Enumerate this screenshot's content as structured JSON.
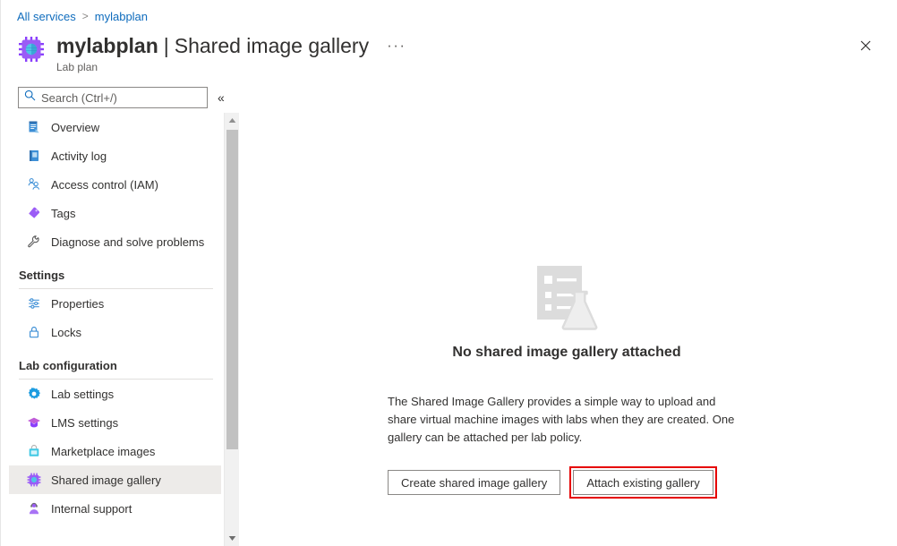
{
  "breadcrumb": {
    "items": [
      {
        "label": "All services",
        "link": true
      },
      {
        "label": "mylabplan",
        "link": true
      }
    ],
    "separator": ">"
  },
  "header": {
    "icon_name": "lab-plan-chip-icon",
    "resource_name": "mylabplan",
    "divider": "|",
    "page_title": "Shared image gallery",
    "subtitle": "Lab plan",
    "more_menu": "···",
    "close_label": "✕"
  },
  "search": {
    "placeholder": "Search (Ctrl+/)",
    "value": "",
    "icon_name": "search-icon",
    "collapse_label": "«"
  },
  "sidebar": {
    "top_items": [
      {
        "label": "Overview",
        "icon": "overview-icon"
      },
      {
        "label": "Activity log",
        "icon": "activity-log-icon"
      },
      {
        "label": "Access control (IAM)",
        "icon": "access-control-icon"
      },
      {
        "label": "Tags",
        "icon": "tags-icon"
      },
      {
        "label": "Diagnose and solve problems",
        "icon": "diagnose-icon"
      }
    ],
    "groups": [
      {
        "title": "Settings",
        "items": [
          {
            "label": "Properties",
            "icon": "properties-icon"
          },
          {
            "label": "Locks",
            "icon": "lock-icon"
          }
        ]
      },
      {
        "title": "Lab configuration",
        "items": [
          {
            "label": "Lab settings",
            "icon": "gear-icon"
          },
          {
            "label": "LMS settings",
            "icon": "graduation-cap-icon"
          },
          {
            "label": "Marketplace images",
            "icon": "marketplace-bag-icon"
          },
          {
            "label": "Shared image gallery",
            "icon": "chip-icon",
            "selected": true
          },
          {
            "label": "Internal support",
            "icon": "support-person-icon"
          }
        ]
      }
    ],
    "scrollbar": {
      "up_arrow": "▲",
      "down_arrow": "▼"
    }
  },
  "main": {
    "illustration_name": "empty-gallery-illustration",
    "empty_title": "No shared image gallery attached",
    "empty_body": "The Shared Image Gallery provides a simple way to upload and share virtual machine images with labs when they are created. One gallery can be attached per lab policy.",
    "primary_button": "Create shared image gallery",
    "secondary_button": "Attach existing gallery",
    "highlight_color": "#e60000"
  }
}
